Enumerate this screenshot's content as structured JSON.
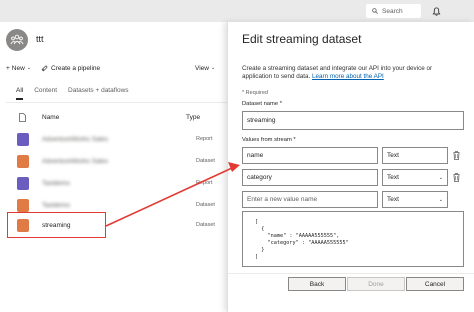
{
  "topbar": {
    "search_placeholder": "Search",
    "search_icon": "search-icon",
    "bell_icon": "bell-icon"
  },
  "workspace": {
    "name": "ttt",
    "avatar_icon": "people-icon"
  },
  "toolbar": {
    "new_label": "New",
    "pipeline_label": "Create a pipeline",
    "view_label": "View"
  },
  "tabs": {
    "all": "All",
    "content": "Content",
    "datasets": "Datasets + dataflows"
  },
  "table": {
    "headers": {
      "name": "Name",
      "type": "Type"
    },
    "rows": [
      {
        "name": "AdventureWorks Sales",
        "type": "Report",
        "color": "#6b5cbf"
      },
      {
        "name": "AdventureWorks Sales",
        "type": "Dataset",
        "color": "#e07b46"
      },
      {
        "name": "Taxidemo",
        "type": "Report",
        "color": "#6b5cbf"
      },
      {
        "name": "Taxidemo",
        "type": "Dataset",
        "color": "#e07b46"
      },
      {
        "name": "streaming",
        "type": "Dataset",
        "color": "#e07b46"
      }
    ]
  },
  "panel": {
    "title": "Edit streaming dataset",
    "description": "Create a streaming dataset and integrate our API into your device or application to send data.",
    "learn_more": "Learn more about the API",
    "required_note": "* Required",
    "dataset_name_label": "Dataset name *",
    "dataset_name_value": "streaming",
    "values_label": "Values from stream *",
    "values": [
      {
        "name": "name",
        "type": "Text"
      },
      {
        "name": "category",
        "type": "Text"
      }
    ],
    "new_value_placeholder": "Enter a new value name",
    "new_value_type": "Text",
    "json_sample": "[\n  {\n    \"name\" : \"AAAAA555555\",\n    \"category\" : \"AAAAA555555\"\n  }\n]",
    "buttons": {
      "back": "Back",
      "done": "Done",
      "cancel": "Cancel"
    }
  },
  "colors": {
    "highlight": "#e23a33",
    "link": "#0062b1",
    "report_icon": "#6b5cbf",
    "dataset_icon": "#e07b46"
  }
}
